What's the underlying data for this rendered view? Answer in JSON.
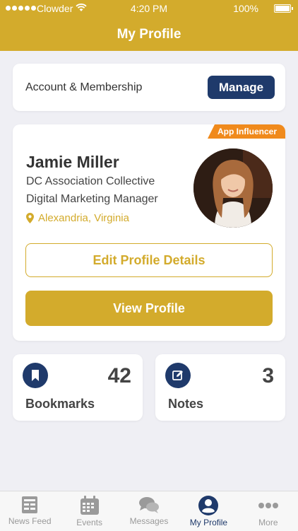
{
  "status_bar": {
    "carrier": "Clowder",
    "time": "4:20 PM",
    "battery": "100%"
  },
  "header": {
    "title": "My Profile"
  },
  "membership": {
    "label": "Account & Membership",
    "manage_label": "Manage"
  },
  "profile": {
    "badge": "App Influencer",
    "name": "Jamie Miller",
    "organization": "DC Association Collective",
    "job_title": "Digital Marketing Manager",
    "location": "Alexandria, Virginia",
    "edit_label": "Edit Profile Details",
    "view_label": "View Profile"
  },
  "stats": {
    "bookmarks": {
      "count": "42",
      "label": "Bookmarks",
      "icon": "bookmark-icon"
    },
    "notes": {
      "count": "3",
      "label": "Notes",
      "icon": "edit-note-icon"
    }
  },
  "tabbar": {
    "items": [
      {
        "label": "News Feed",
        "icon": "news-feed-icon"
      },
      {
        "label": "Events",
        "icon": "calendar-icon"
      },
      {
        "label": "Messages",
        "icon": "chat-bubbles-icon"
      },
      {
        "label": "My Profile",
        "icon": "user-icon",
        "active": true
      },
      {
        "label": "More",
        "icon": "more-dots-icon"
      }
    ]
  },
  "colors": {
    "accent": "#d3ab2c",
    "navy": "#1f3a6b",
    "badge": "#f08a1c",
    "background": "#efeff4"
  }
}
